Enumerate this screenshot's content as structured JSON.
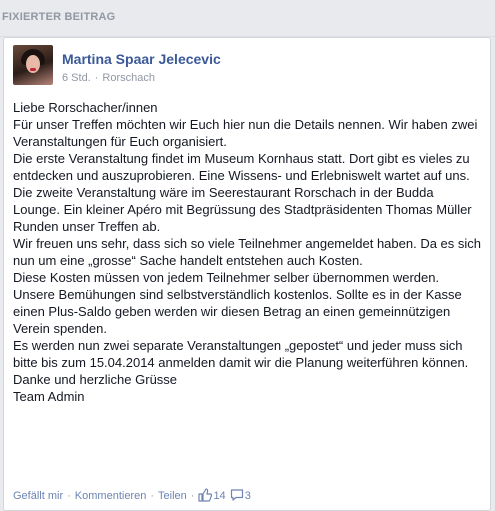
{
  "section": {
    "title": "FIXIERTER BEITRAG"
  },
  "post": {
    "author": "Martina Spaar Jelecevic",
    "time": "6 Std.",
    "location": "Rorschach",
    "paragraphs": [
      "Liebe Rorschacher/innen",
      "Für unser Treffen möchten wir Euch hier nun die Details nennen. Wir haben zwei Veranstaltungen für Euch organisiert.",
      "Die erste Veranstaltung findet im Museum Kornhaus statt. Dort gibt es vieles zu entdecken und auszuprobieren. Eine Wissens- und Erlebniswelt wartet auf uns.",
      "Die zweite Veranstaltung wäre im Seerestaurant Rorschach in der Budda Lounge. Ein kleiner Apéro mit Begrüssung des Stadtpräsidenten Thomas Müller Runden unser Treffen ab.",
      "Wir freuen uns sehr, dass sich so viele Teilnehmer angemeldet haben. Da es sich nun um eine „grosse“ Sache handelt entstehen auch Kosten.",
      "Diese Kosten müssen von jedem Teilnehmer selber übernommen werden. Unsere Bemühungen sind selbstverständlich kostenlos. Sollte es in der Kasse einen Plus-Saldo geben werden wir diesen Betrag an einen gemeinnützigen Verein spenden.",
      "Es werden nun zwei separate Veranstaltungen „gepostet“ und jeder muss sich bitte bis zum 15.04.2014 anmelden damit wir die Planung weiterführen können.",
      "Danke und herzliche Grüsse",
      "Team Admin"
    ]
  },
  "actions": {
    "like": "Gefällt mir",
    "comment": "Kommentieren",
    "share": "Teilen",
    "like_count": "14",
    "comment_count": "3"
  },
  "icons": {
    "location": "globe-icon",
    "likes": "thumbs-up-icon",
    "comments": "comment-bubble-icon"
  },
  "colors": {
    "link": "#3b5998",
    "meta": "#9197a3",
    "action_link": "#6d84b4",
    "text": "#141823",
    "background": "#e9eaed"
  }
}
